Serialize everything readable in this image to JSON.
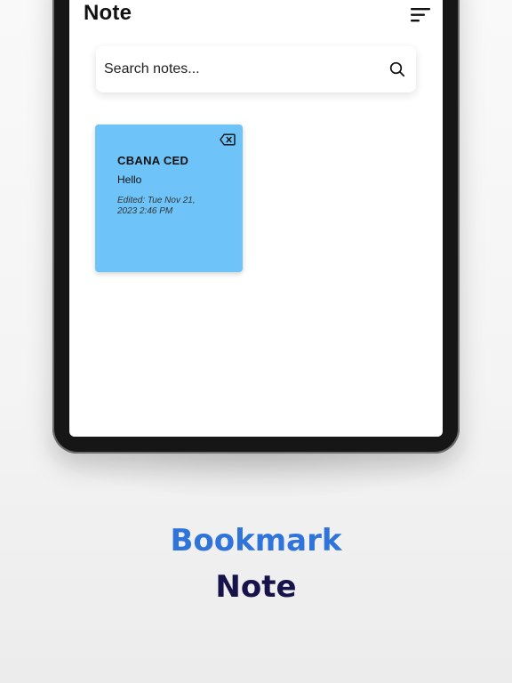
{
  "app": {
    "title": "Note"
  },
  "search": {
    "placeholder": "Search notes..."
  },
  "notes": [
    {
      "title": "CBANA CED",
      "body": "Hello",
      "edited": "Edited: Tue Nov 21, 2023 2:46 PM",
      "color": "#6ec4f8"
    }
  ],
  "caption": {
    "line1": "Bookmark",
    "line2": "Note"
  },
  "icons": {
    "menu": "sort-menu-icon",
    "search": "search-icon",
    "delete": "backspace-icon"
  },
  "colors": {
    "accent": "#2e74db",
    "dark": "#17134a",
    "device": "#161616"
  }
}
